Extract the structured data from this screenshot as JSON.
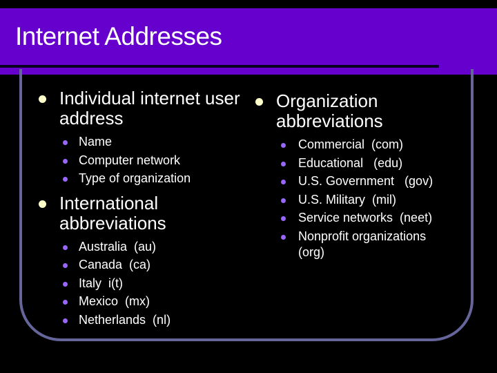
{
  "slide": {
    "title": "Internet Addresses",
    "colors": {
      "title_bar": "#6600cc",
      "background": "#000000",
      "frame": "#65659a",
      "level1_bullet": "#ffffcc",
      "level2_bullet": "#9966ff"
    },
    "left_column": [
      {
        "label": "Individual internet user address",
        "bullet_icon": "circle-bullet",
        "items": [
          "Name",
          "Computer network",
          "Type of organization"
        ]
      },
      {
        "label": "International abbreviations",
        "bullet_icon": "circle-bullet",
        "items": [
          "Australia  (au)",
          "Canada  (ca)",
          "Italy  i(t)",
          "Mexico  (mx)",
          "Netherlands  (nl)"
        ]
      }
    ],
    "right_column": [
      {
        "label": "Organization abbreviations",
        "bullet_icon": "circle-bullet",
        "items": [
          "Commercial  (com)",
          "Educational   (edu)",
          "U.S. Government   (gov)",
          "U.S. Military  (mil)",
          "Service networks  (neet)",
          "Nonprofit organizations (org)"
        ]
      }
    ]
  }
}
